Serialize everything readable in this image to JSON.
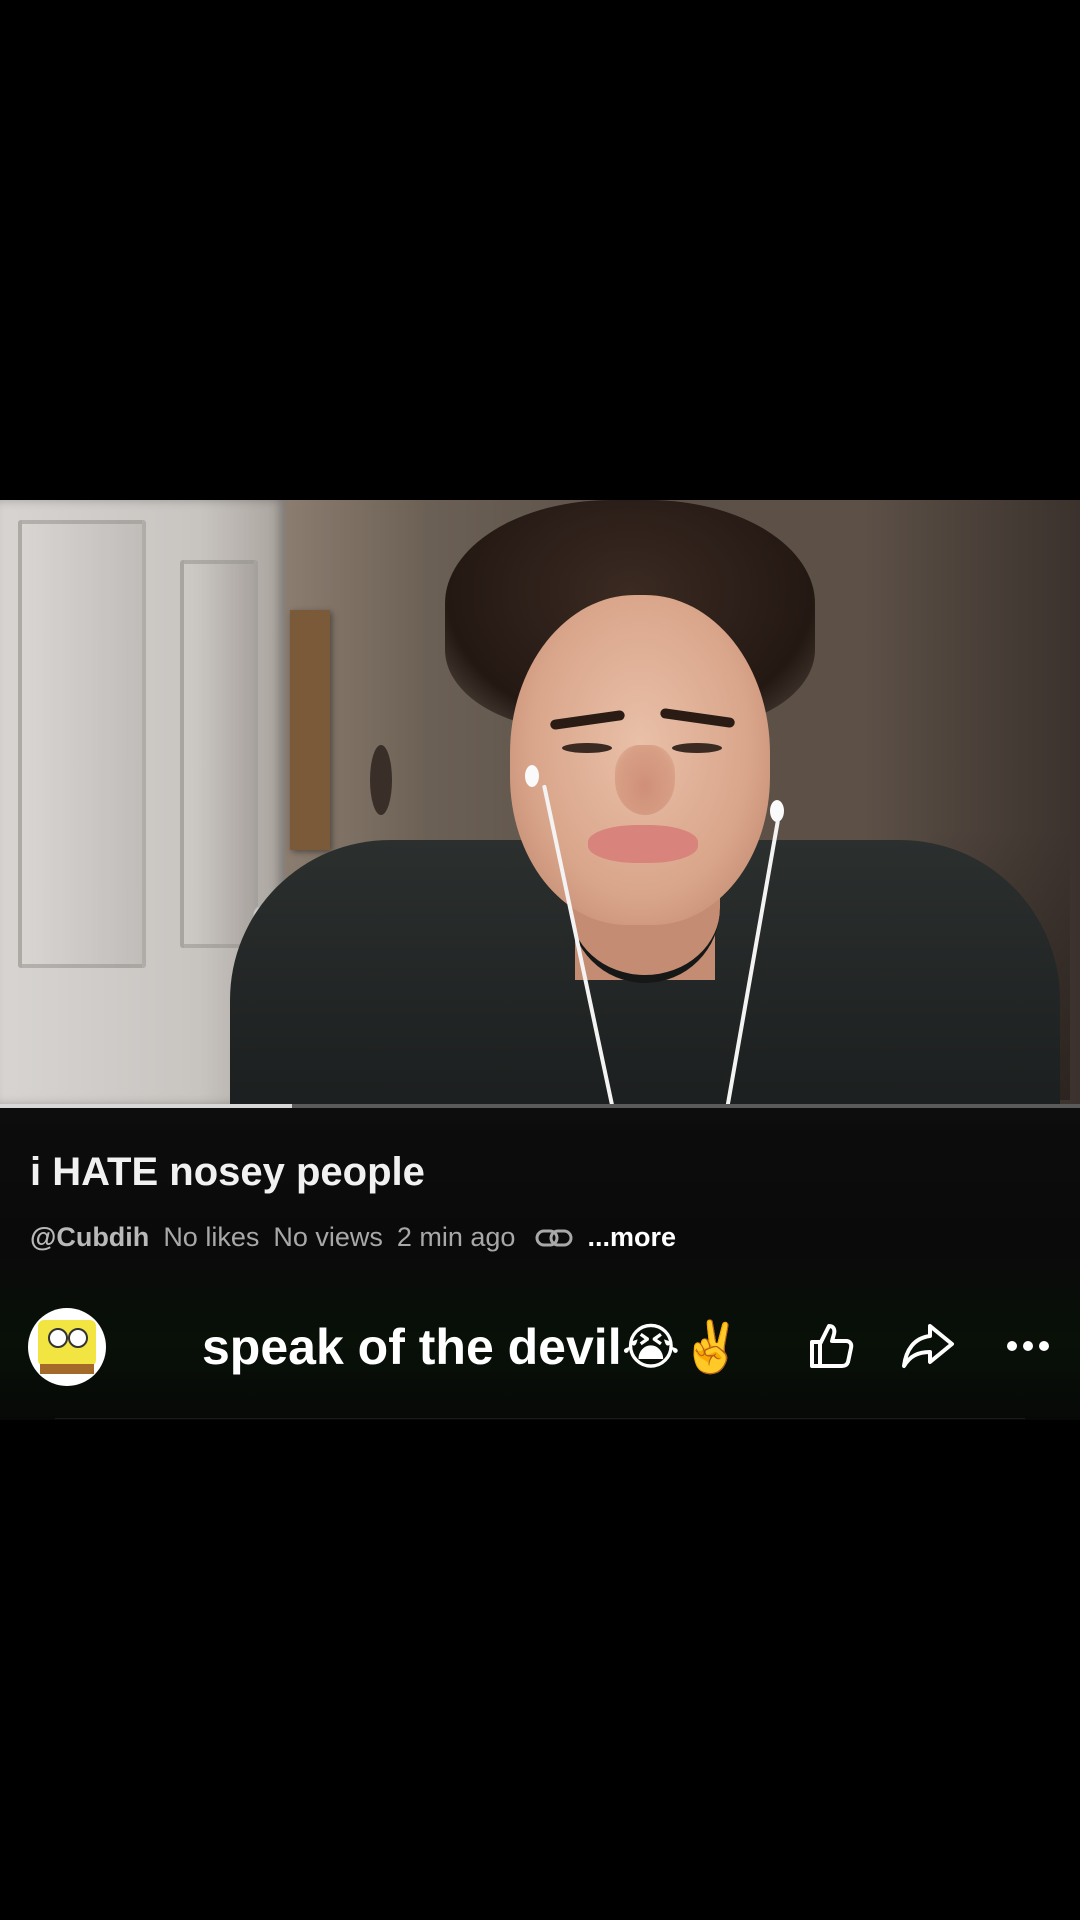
{
  "video": {
    "progress_fraction": 0.27
  },
  "info": {
    "title": "i HATE nosey people",
    "channel": "@Cubdih",
    "likes": "No likes",
    "views": "No views",
    "time_ago": "2 min ago",
    "more_label": "...more"
  },
  "bottom": {
    "caption": "speak of the devil😭✌️"
  },
  "icons": {
    "link": "link-icon",
    "like": "thumbs-up-icon",
    "share": "share-icon",
    "more": "more-horizontal-icon"
  }
}
